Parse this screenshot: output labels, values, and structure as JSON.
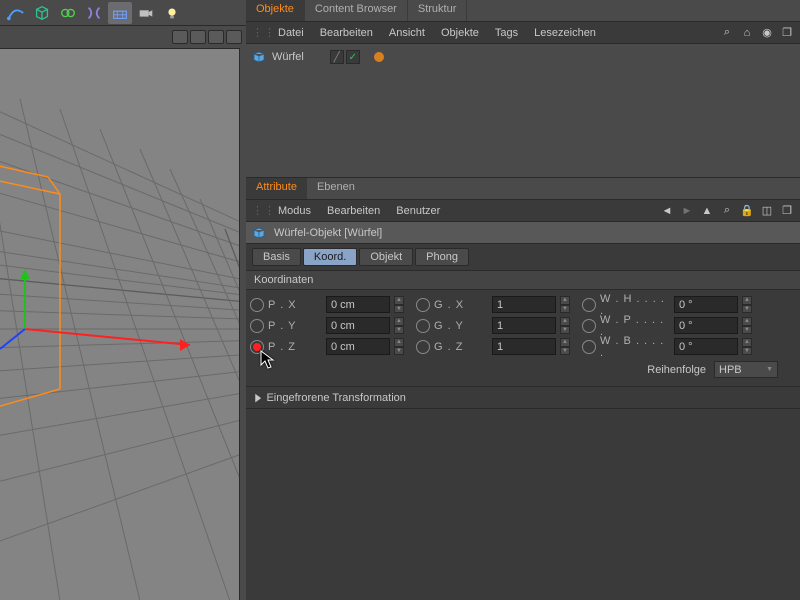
{
  "top_tabs": {
    "objekte": "Objekte",
    "content_browser": "Content Browser",
    "struktur": "Struktur"
  },
  "obj_menu": {
    "datei": "Datei",
    "bearbeiten": "Bearbeiten",
    "ansicht": "Ansicht",
    "objekte": "Objekte",
    "tags": "Tags",
    "lesezeichen": "Lesezeichen"
  },
  "hierarchy": {
    "item0": "Würfel"
  },
  "attr_tabs": {
    "attribute": "Attribute",
    "ebenen": "Ebenen"
  },
  "attr_menu": {
    "modus": "Modus",
    "bearbeiten": "Bearbeiten",
    "benutzer": "Benutzer"
  },
  "attr_header": "Würfel-Objekt [Würfel]",
  "subtabs": {
    "basis": "Basis",
    "koord": "Koord.",
    "objekt": "Objekt",
    "phong": "Phong"
  },
  "section_koord": "Koordinaten",
  "labels": {
    "px": "P . X",
    "py": "P . Y",
    "pz": "P . Z",
    "gx": "G . X",
    "gy": "G . Y",
    "gz": "G . Z",
    "wh": "W . H . . . . .",
    "wp": "W . P . . . . .",
    "wb": "W . B . . . . ."
  },
  "values": {
    "px": "0 cm",
    "py": "0 cm",
    "pz": "0 cm",
    "gx": "1",
    "gy": "1",
    "gz": "1",
    "wh": "0 °",
    "wp": "0 °",
    "wb": "0 °"
  },
  "reihenfolge_label": "Reihenfolge",
  "reihenfolge_value": "HPB",
  "expander": "Eingefrorene Transformation"
}
